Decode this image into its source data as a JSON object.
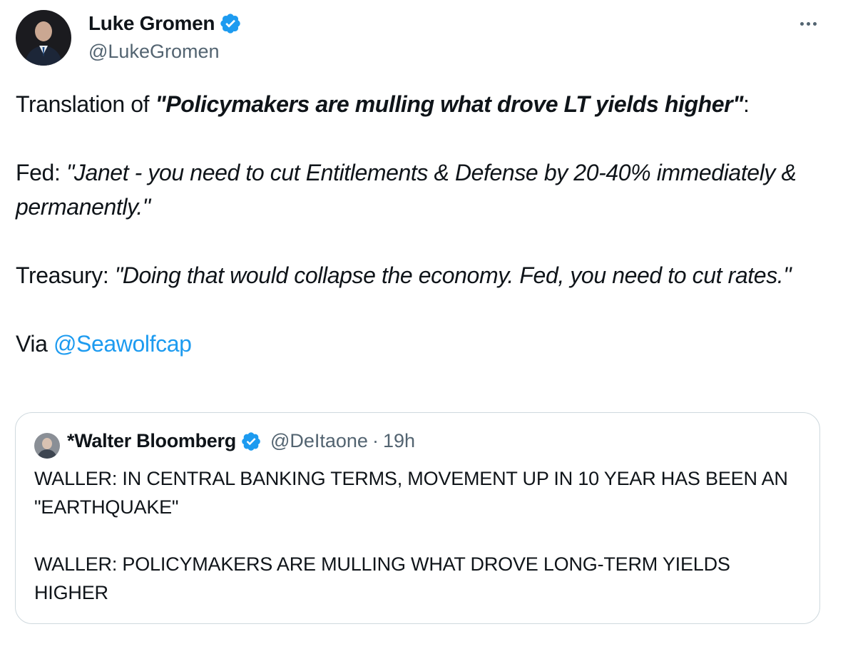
{
  "author": {
    "display_name": "Luke Gromen",
    "handle": "@LukeGromen",
    "verified_icon": "verified-badge-icon"
  },
  "tweet": {
    "line1_prefix": "Translation of ",
    "line1_bold": "\"Policymakers are mulling what drove LT yields higher\"",
    "line1_suffix": ":",
    "fed_label": "Fed:  ",
    "fed_quote": "\"Janet - you need to cut Entitlements & Defense by 20-40% immediately & permanently.\"",
    "treasury_label": "Treasury:  ",
    "treasury_quote": "\"Doing that would collapse the economy.  Fed, you need to cut rates.\"",
    "via_label": "Via ",
    "via_mention": "@Seawolfcap"
  },
  "quoted_tweet": {
    "display_name": "*Walter Bloomberg",
    "handle": "@DeItaone",
    "separator": "·",
    "time": "19h",
    "paragraph1": "WALLER: IN CENTRAL BANKING TERMS, MOVEMENT UP IN 10 YEAR HAS BEEN AN \"EARTHQUAKE\"",
    "paragraph2": "WALLER: POLICYMAKERS ARE MULLING WHAT DROVE LONG-TERM YIELDS HIGHER"
  },
  "colors": {
    "text": "#0f1419",
    "secondary": "#536471",
    "link": "#1d9bf0",
    "verified": "#1d9bf0",
    "border": "#cfd9de"
  }
}
